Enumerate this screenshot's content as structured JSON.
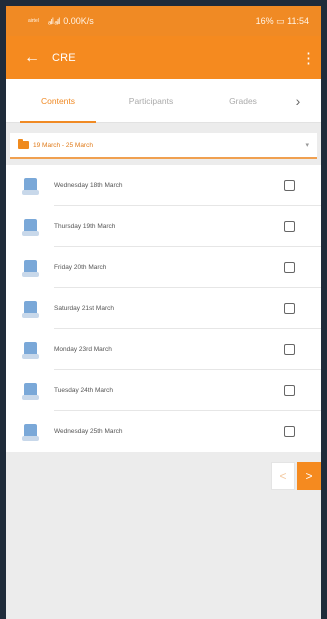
{
  "status_bar": {
    "carrier": "airtel",
    "signal": "ₐıl ₐıl",
    "data_rate": "0.00K/s",
    "right": "16% ▭ 11:54"
  },
  "app_bar": {
    "back_icon": "arrow-left-icon",
    "title": "CRE",
    "menu_icon": "more-vert-icon"
  },
  "tabs": [
    {
      "label": "Contents",
      "active": true
    },
    {
      "label": "Participants",
      "active": false
    },
    {
      "label": "Grades",
      "active": false
    }
  ],
  "section_select": {
    "label": "19 March - 25 March",
    "icon": "folder-icon"
  },
  "items": [
    {
      "label": "Wednesday 18th March"
    },
    {
      "label": "Thursday 19th March"
    },
    {
      "label": "Friday 20th March"
    },
    {
      "label": "Saturday 21st March"
    },
    {
      "label": "Monday 23rd March"
    },
    {
      "label": "Tuesday 24th March"
    },
    {
      "label": "Wednesday 25th March"
    }
  ],
  "pager": {
    "prev": "<",
    "next": ">"
  },
  "colors": {
    "accent": "#f58a1f",
    "background": "#ececec"
  }
}
